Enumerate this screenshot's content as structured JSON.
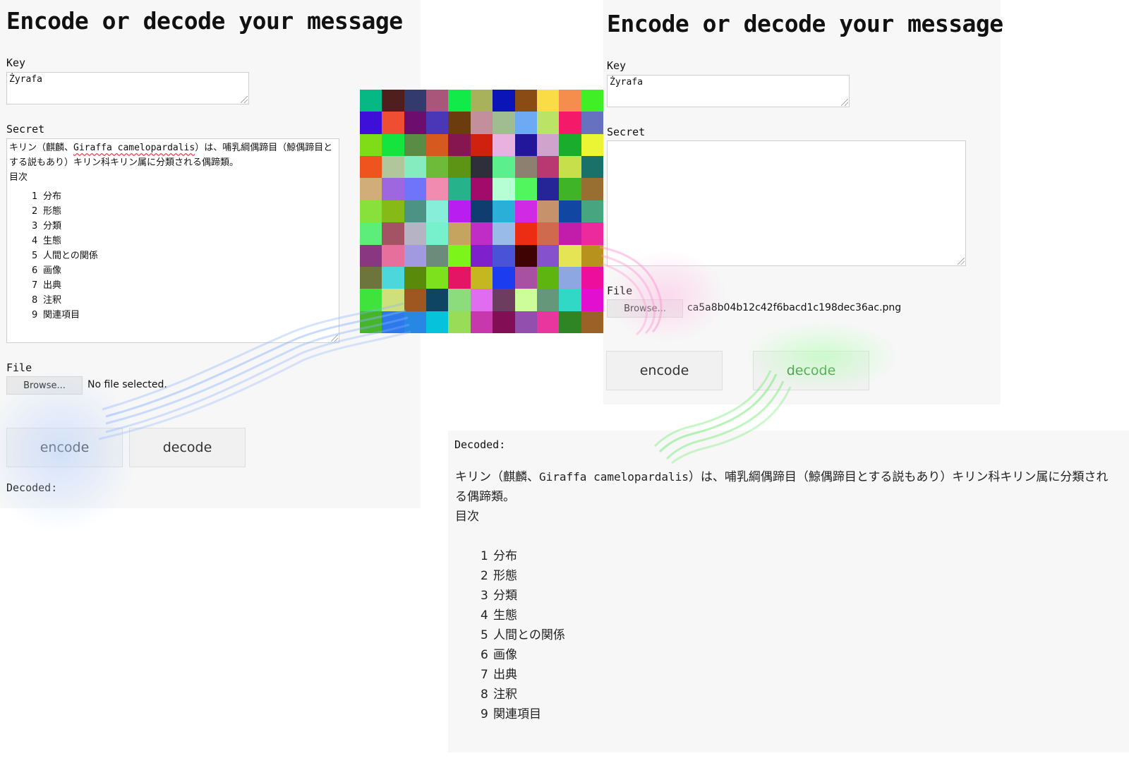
{
  "left_form": {
    "title": "Encode or decode your message",
    "key_label": "Key",
    "key_value": "Żyrafa",
    "secret_label": "Secret",
    "secret_intro_1": "キリン（麒麟、",
    "secret_latin": "Giraffa camelopardalis",
    "secret_intro_2": "）は、哺乳綱偶蹄目（鯨偶蹄目とする説もあり）キリン科キリン属に分類される偶蹄類。",
    "secret_heading": "目次",
    "secret_toc": [
      {
        "num": "1",
        "text": "分布"
      },
      {
        "num": "2",
        "text": "形態"
      },
      {
        "num": "3",
        "text": "分類"
      },
      {
        "num": "4",
        "text": "生態"
      },
      {
        "num": "5",
        "text": "人間との関係"
      },
      {
        "num": "6",
        "text": "画像"
      },
      {
        "num": "7",
        "text": "出典"
      },
      {
        "num": "8",
        "text": "注釈"
      },
      {
        "num": "9",
        "text": "関連項目"
      }
    ],
    "file_label": "File",
    "browse_label": "Browse...",
    "file_name": "No file selected.",
    "encode_label": "encode",
    "decode_label": "decode",
    "decoded_label": "Decoded:"
  },
  "right_form": {
    "title": "Encode or decode your message",
    "key_label": "Key",
    "key_value": "Żyrafa",
    "secret_label": "Secret",
    "secret_value": "",
    "file_label": "File",
    "browse_label": "Browse...",
    "file_name": "ca5a8b04b12c42f6bacd1c198dec36ac.png",
    "encode_label": "encode",
    "decode_label": "decode"
  },
  "decoded_panel": {
    "label": "Decoded:",
    "intro_1": "キリン（麒麟、",
    "latin": "Giraffa camelopardalis",
    "intro_2": "）は、哺乳綱偶蹄目（鯨偶蹄目とする説もあり）キリン科キリン属に分類される偶蹄類。",
    "heading": "目次",
    "toc": [
      {
        "num": "1",
        "text": "分布"
      },
      {
        "num": "2",
        "text": "形態"
      },
      {
        "num": "3",
        "text": "分類"
      },
      {
        "num": "4",
        "text": "生態"
      },
      {
        "num": "5",
        "text": "人間との関係"
      },
      {
        "num": "6",
        "text": "画像"
      },
      {
        "num": "7",
        "text": "出典"
      },
      {
        "num": "8",
        "text": "注釈"
      },
      {
        "num": "9",
        "text": "関連項目"
      }
    ]
  },
  "encoded_image": {
    "grid_size": 11,
    "colors": [
      "#08b884",
      "#4e1f1c",
      "#333a6e",
      "#a9567a",
      "#12ea4a",
      "#a7b25a",
      "#0b14b7",
      "#8a4c12",
      "#fadc47",
      "#f58d4d",
      "#40ef25",
      "#3d0fd8",
      "#ef4e33",
      "#6d0d6d",
      "#4a37b8",
      "#6b3d0e",
      "#c38f9c",
      "#9fbd91",
      "#6eaaf3",
      "#bbe466",
      "#f5196a",
      "#6671bf",
      "#7fdc17",
      "#16e43e",
      "#5a8c45",
      "#d65a1f",
      "#85164f",
      "#cf210d",
      "#e9b1df",
      "#22169a",
      "#d0a3cc",
      "#1aac2d",
      "#ecf534",
      "#ef541e",
      "#b1c69a",
      "#85ecbf",
      "#6ebb3a",
      "#5d9416",
      "#2e2f3a",
      "#5cef8e",
      "#8e8070",
      "#b93872",
      "#c7df4b",
      "#19716a",
      "#d1ae79",
      "#9e67e0",
      "#6f74fb",
      "#f28bb0",
      "#26b28a",
      "#a20b6a",
      "#b6ffd4",
      "#51f55d",
      "#262597",
      "#3fb427",
      "#986f30",
      "#88e03a",
      "#86bb17",
      "#4c9385",
      "#87efd9",
      "#b81ef0",
      "#0f3d6f",
      "#2ab0d8",
      "#d02ae5",
      "#c5926c",
      "#1147a2",
      "#47a57f",
      "#5ded7b",
      "#a35364",
      "#b6b4c4",
      "#77f0cc",
      "#c4a45e",
      "#c02cc6",
      "#98bbe7",
      "#ec2d14",
      "#cf6a4c",
      "#c21cab",
      "#ec2a9d",
      "#8a3782",
      "#e76f9b",
      "#a29ae0",
      "#6d8b7a",
      "#7cf51b",
      "#7e20cb",
      "#4a52d8",
      "#3f0303",
      "#8652cc",
      "#e5e454",
      "#b7931d",
      "#6e753c",
      "#4bd7dc",
      "#598a0a",
      "#7de21d",
      "#e41565",
      "#c4b71f",
      "#1c3cf0",
      "#a851a3",
      "#5eb50f",
      "#8ca7e2",
      "#ee0e9e",
      "#3fe33c",
      "#cde07b",
      "#9e5720",
      "#0e4562",
      "#8cdc7e",
      "#e06cf0",
      "#6c3d5f",
      "#ccfd9a",
      "#65977b",
      "#30d8c5",
      "#e30fd0",
      "#47b52c",
      "#2b79ea",
      "#2788e4",
      "#06c2db",
      "#98dc58",
      "#c638ab",
      "#820e55",
      "#924fae",
      "#e8369e",
      "#2f8424",
      "#9b6127"
    ]
  }
}
